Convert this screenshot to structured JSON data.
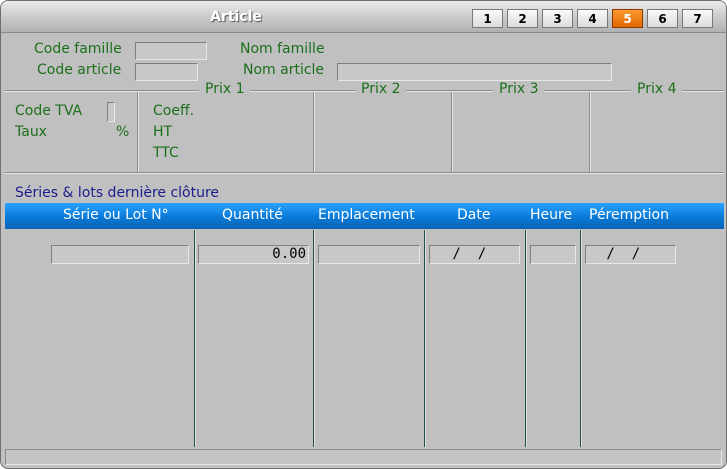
{
  "window": {
    "title": "Article"
  },
  "tabs": [
    {
      "label": "1",
      "active": false
    },
    {
      "label": "2",
      "active": false
    },
    {
      "label": "3",
      "active": false
    },
    {
      "label": "4",
      "active": false
    },
    {
      "label": "5",
      "active": true
    },
    {
      "label": "6",
      "active": false
    },
    {
      "label": "7",
      "active": false
    }
  ],
  "header": {
    "code_famille_label": "Code famille",
    "code_article_label": "Code article",
    "nom_famille_label": "Nom famille",
    "nom_article_label": "Nom article",
    "code_famille_value": "",
    "code_article_value": "",
    "nom_article_value": ""
  },
  "tva": {
    "code_tva_label": "Code TVA",
    "taux_label": "Taux",
    "percent_sign": "%",
    "code_tva_value": ""
  },
  "prices": {
    "coeff_label": "Coeff.",
    "ht_label": "HT",
    "ttc_label": "TTC",
    "columns": [
      "Prix 1",
      "Prix 2",
      "Prix 3",
      "Prix 4"
    ]
  },
  "lots": {
    "title": "Séries & lots dernière clôture",
    "columns": [
      "Série ou Lot N°",
      "Quantité",
      "Emplacement",
      "Date",
      "Heure",
      "Péremption"
    ],
    "row": {
      "serie": "",
      "quantite": "0.00",
      "emplacement": "",
      "date": " /  /",
      "heure": "",
      "peremption": " /  /"
    }
  },
  "colors": {
    "label_green": "#1b6f1b",
    "section_blue": "#1c1c8c",
    "active_tab_orange": "#f07a10",
    "header_blue": "#0a79d6"
  }
}
